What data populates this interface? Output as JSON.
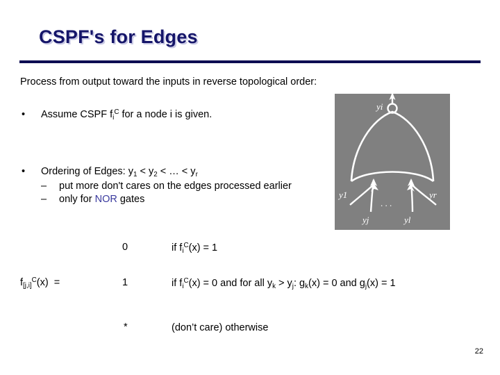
{
  "slide": {
    "title": "CSPF's for Edges",
    "page_number": "22",
    "lead_text": "Process from output toward the inputs in reverse topological order:",
    "accent_color": "#151569",
    "rule_color": "#0d0d52",
    "nor_highlight_color": "#3a3a9e",
    "figure_background": "#808080",
    "figure_line_color": "#ffffff"
  },
  "bullets": [
    {
      "marker": "•",
      "text_parts": {
        "pre": "Assume CSPF f",
        "sub": "i",
        "sup": "C",
        "post": " for a node i is given."
      }
    },
    {
      "marker": "•",
      "text_parts": {
        "pre": "Ordering of Edges: y",
        "sub1": "1",
        "mid1": " < y",
        "sub2": "2",
        "mid2": " < … < y",
        "sub3": "r"
      },
      "subbullets": [
        {
          "marker": "–",
          "text": "put more don't cares on the edges processed earlier"
        },
        {
          "marker": "–",
          "pre": "only for ",
          "highlight": "NOR",
          "post": " gates"
        }
      ]
    }
  ],
  "equation": {
    "lhs": {
      "fn": "f",
      "sub": "[j,i]",
      "sup": "C",
      "arg": "(x)",
      "equals": "="
    },
    "rows": [
      {
        "value": "0",
        "condition": {
          "pre": "if f",
          "sub": "i",
          "sup": "C",
          "post": "(x) = 1"
        }
      },
      {
        "value": "1",
        "condition": {
          "pre": "if f",
          "sub": "i",
          "sup": "C",
          "post": "(x) = 0 and for all y",
          "sub_k": "k",
          "gt": " > y",
          "sub_j": "j",
          "mid": ": g",
          "sub_k2": "k",
          "tail": "(x) = 0 and g",
          "sub_j2": "j",
          "end": "(x) = 1"
        }
      },
      {
        "value": "*",
        "condition": {
          "text": "(don’t care) otherwise"
        }
      }
    ]
  },
  "figure": {
    "name": "nor-gate-diagram",
    "output_label": "yi",
    "input_labels": [
      "y1",
      "yj",
      "yl",
      "yr"
    ],
    "ellipsis": ". . ."
  }
}
